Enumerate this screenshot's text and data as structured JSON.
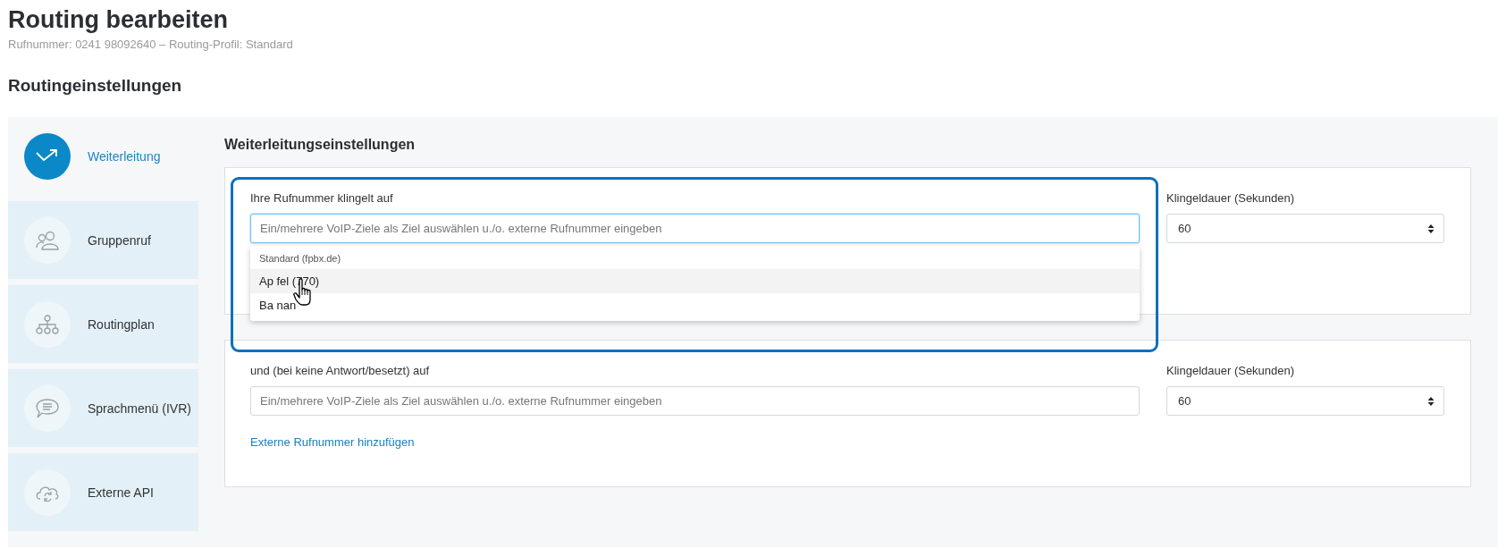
{
  "header": {
    "title": "Routing bearbeiten",
    "subtitle": "Rufnummer: 0241 98092640 – Routing-Profil: Standard"
  },
  "section_title": "Routingeinstellungen",
  "sidebar": {
    "items": [
      {
        "kind": "forward",
        "label": "Weiterleitung",
        "selected": true
      },
      {
        "kind": "group",
        "label": "Gruppenruf",
        "selected": false
      },
      {
        "kind": "plan",
        "label": "Routingplan",
        "selected": false
      },
      {
        "kind": "ivr",
        "label": "Sprachmenü (IVR)",
        "selected": false
      },
      {
        "kind": "api",
        "label": "Externe API",
        "selected": false
      }
    ]
  },
  "main": {
    "title": "Weiterleitungseinstellungen",
    "rules": [
      {
        "label": "Ihre Rufnummer klingelt auf",
        "placeholder": "Ein/mehrere VoIP-Ziele als Ziel auswählen u./o. externe Rufnummer eingeben",
        "focused": true,
        "highlighted": true,
        "duration_label": "Klingeldauer (Sekunden)",
        "duration_value": "60",
        "dropdown": {
          "group": "Standard (fpbx.de)",
          "options": [
            {
              "label": "Ap fel (770)",
              "selected": true
            },
            {
              "label": "Ba nan",
              "selected": false
            }
          ]
        }
      },
      {
        "label": "und (bei keine Antwort/besetzt) auf",
        "placeholder": "Ein/mehrere VoIP-Ziele als Ziel auswählen u./o. externe Rufnummer eingeben",
        "focused": false,
        "highlighted": false,
        "duration_label": "Klingeldauer (Sekunden)",
        "duration_value": "60",
        "link": "Externe Rufnummer hinzufügen"
      }
    ]
  }
}
